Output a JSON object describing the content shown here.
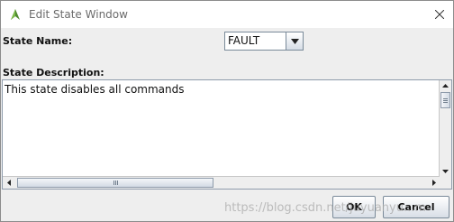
{
  "window": {
    "title": "Edit State Window",
    "close_icon": "close-icon",
    "app_icon": "app-icon"
  },
  "state_name": {
    "label": "State Name:",
    "selected_value": "FAULT"
  },
  "state_description": {
    "label": "State Description:",
    "value": "This state disables all commands"
  },
  "buttons": {
    "ok_label": "OK",
    "cancel_label": "Cancel"
  },
  "watermark": "https://blog.csdn.net/juyuanyu...m",
  "colors": {
    "window_bg": "#eeeeee",
    "titlebar_bg": "#ffffff",
    "border": "#7a8a99"
  }
}
